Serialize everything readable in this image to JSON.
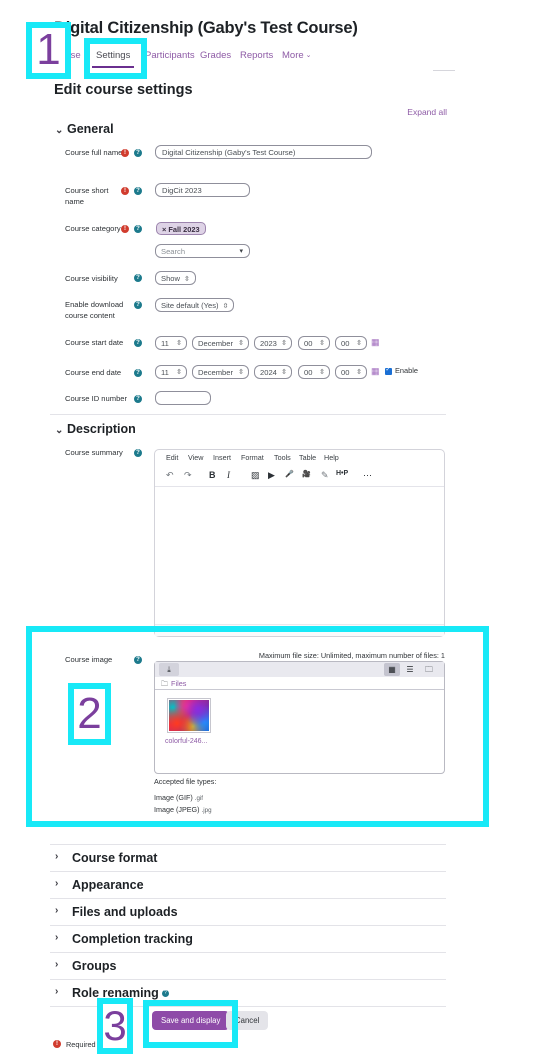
{
  "header": {
    "course_title": "Digital Citizenship (Gaby's Test Course)",
    "page_heading": "Edit course settings",
    "expand_all": "Expand all",
    "tabs": [
      {
        "label": "Course",
        "active": false
      },
      {
        "label": "Settings",
        "active": true
      },
      {
        "label": "Participants",
        "active": false
      },
      {
        "label": "Grades",
        "active": false
      },
      {
        "label": "Reports",
        "active": false
      },
      {
        "label": "More",
        "active": false,
        "chevron": "⌄"
      }
    ]
  },
  "sections": {
    "general": "General",
    "description": "Description"
  },
  "general": {
    "course_full_name": {
      "label": "Course full name",
      "value": "Digital Citizenship (Gaby's Test Course)",
      "required": true
    },
    "course_short_name": {
      "label": "Course short name",
      "value": "DigCit 2023",
      "required": true
    },
    "course_category": {
      "label": "Course category",
      "chip": "× Fall 2023",
      "search_placeholder": "Search",
      "required": true
    },
    "course_visibility": {
      "label": "Course visibility",
      "value": "Show"
    },
    "enable_download": {
      "label": "Enable download course content",
      "value": "Site default (Yes)"
    },
    "course_start_date": {
      "label": "Course start date",
      "day": "11",
      "month": "December",
      "year": "2023",
      "hour": "00",
      "minute": "00"
    },
    "course_end_date": {
      "label": "Course end date",
      "day": "11",
      "month": "December",
      "year": "2024",
      "hour": "00",
      "minute": "00",
      "enable_label": "Enable"
    },
    "course_id_number": {
      "label": "Course ID number",
      "value": ""
    }
  },
  "description": {
    "course_summary_label": "Course summary",
    "editor_menu": [
      "Edit",
      "View",
      "Insert",
      "Format",
      "Tools",
      "Table",
      "Help"
    ],
    "editor_tools": [
      "undo-icon",
      "redo-icon",
      "bold-icon",
      "italic-icon",
      "image-icon",
      "video-embed-icon",
      "microphone-icon",
      "camera-icon",
      "link-icon",
      "h5p-icon",
      "more-icon"
    ],
    "editor_tool_glyphs": [
      "↶",
      "↷",
      "B",
      "I",
      "▨",
      "▶",
      "🎤",
      "🎥",
      "✎",
      "H•P",
      "⋯"
    ],
    "course_image": {
      "label": "Course image",
      "max_file_size": "Maximum file size: Unlimited, maximum number of files: 1",
      "upload_icon": "upload-icon",
      "view_grid_icon": "grid-view-icon",
      "view_list_icon": "list-view-icon",
      "view_tree_icon": "tree-view-icon",
      "breadcrumb": "Files",
      "file_name": "colorful-246...",
      "accepted_title": "Accepted file types:",
      "accepted_types": [
        {
          "name": "Image (GIF)",
          "ext": ".gif"
        },
        {
          "name": "Image (JPEG)",
          "ext": ".jpg"
        }
      ]
    }
  },
  "collapsed_sections": [
    {
      "label": "Course format",
      "help": false
    },
    {
      "label": "Appearance",
      "help": false
    },
    {
      "label": "Files and uploads",
      "help": false
    },
    {
      "label": "Completion tracking",
      "help": false
    },
    {
      "label": "Groups",
      "help": false
    },
    {
      "label": "Role renaming",
      "help": true
    }
  ],
  "footer": {
    "save_label": "Save and display",
    "cancel_label": "Cancel",
    "required_note": "Required"
  },
  "annotations": {
    "accent_color": "#18e9f7",
    "number_color": "#7b3f9d",
    "items": [
      {
        "number": "1",
        "target": "settings-tab"
      },
      {
        "number": "2",
        "target": "course-image-field"
      },
      {
        "number": "3",
        "target": "save-and-display-button"
      }
    ]
  }
}
